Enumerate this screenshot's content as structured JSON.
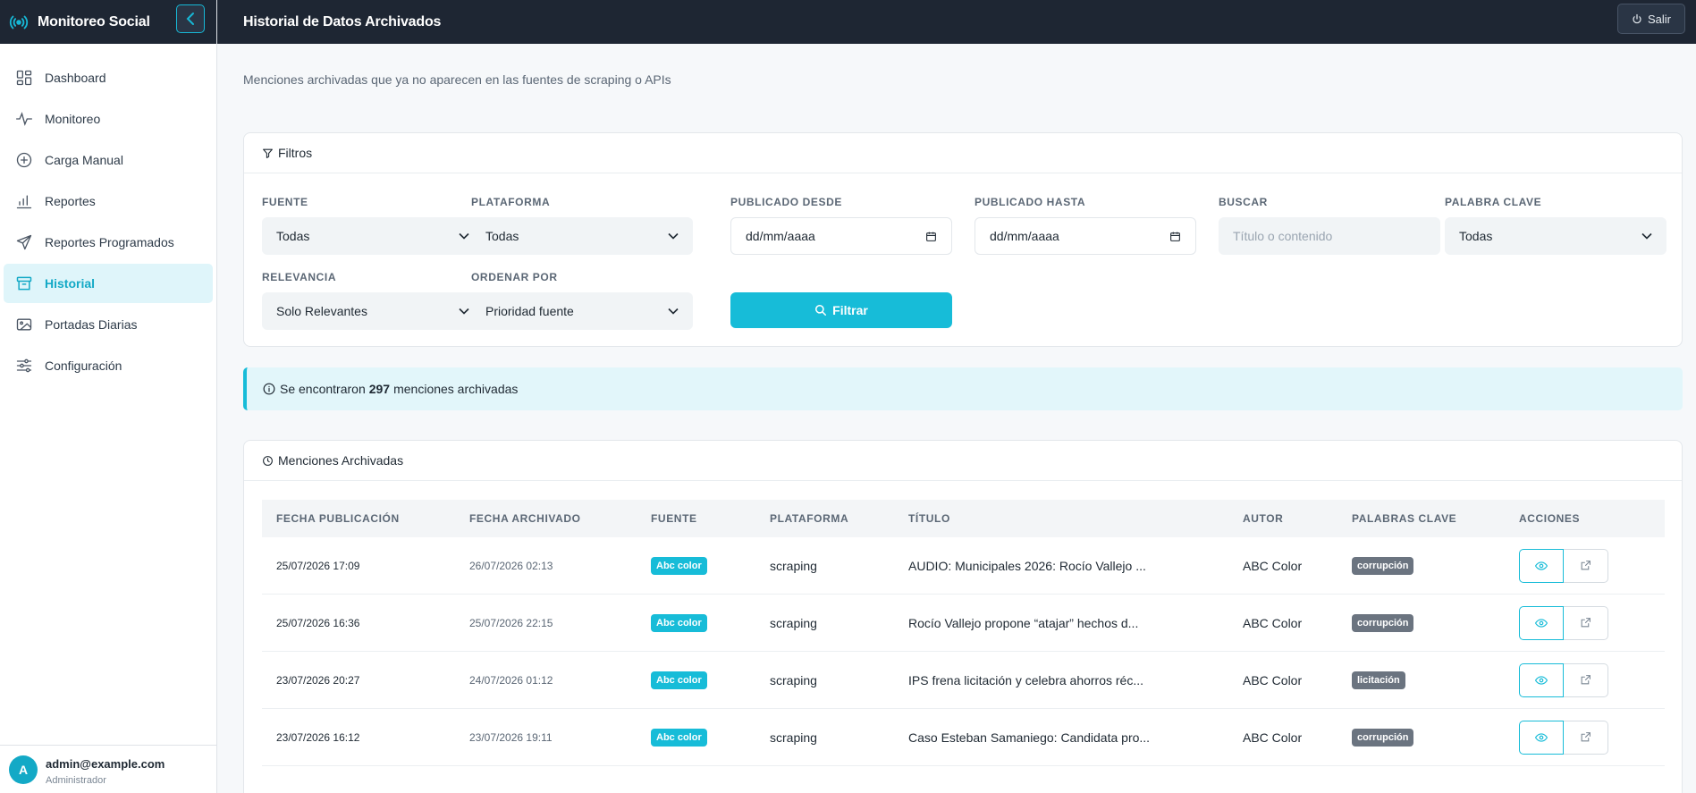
{
  "app": {
    "title": "Monitoreo Social"
  },
  "sidebar": {
    "items": [
      {
        "label": "Dashboard",
        "icon": "dashboard-icon"
      },
      {
        "label": "Monitoreo",
        "icon": "activity-icon"
      },
      {
        "label": "Carga Manual",
        "icon": "plus-circle-icon"
      },
      {
        "label": "Reportes",
        "icon": "bar-chart-icon"
      },
      {
        "label": "Reportes Programados",
        "icon": "send-icon"
      },
      {
        "label": "Historial",
        "icon": "archive-icon",
        "active": true
      },
      {
        "label": "Portadas Diarias",
        "icon": "images-icon"
      },
      {
        "label": "Configuración",
        "icon": "sliders-icon"
      }
    ],
    "user": {
      "initial": "A",
      "email": "admin@example.com",
      "role": "Administrador"
    }
  },
  "header": {
    "title": "Historial de Datos Archivados",
    "logout_label": "Salir"
  },
  "page": {
    "subtitle": "Menciones archivadas que ya no aparecen en las fuentes de scraping o APIs"
  },
  "filters": {
    "title": "Filtros",
    "fuente": {
      "label": "Fuente",
      "value": "Todas"
    },
    "plataforma": {
      "label": "Plataforma",
      "value": "Todas"
    },
    "desde": {
      "label": "Publicado desde",
      "value": "dd/mm/aaaa"
    },
    "hasta": {
      "label": "Publicado hasta",
      "value": "dd/mm/aaaa"
    },
    "buscar": {
      "label": "Buscar",
      "placeholder": "Título o contenido"
    },
    "palabra": {
      "label": "Palabra clave",
      "value": "Todas"
    },
    "relevancia": {
      "label": "Relevancia",
      "value": "Solo Relevantes"
    },
    "ordenar": {
      "label": "Ordenar por",
      "value": "Prioridad fuente"
    },
    "button_label": "Filtrar"
  },
  "alert": {
    "prefix": "Se encontraron",
    "count": "297",
    "suffix": "menciones archivadas"
  },
  "table": {
    "title": "Menciones Archivadas",
    "columns": [
      "Fecha Publicación",
      "Fecha Archivado",
      "Fuente",
      "Plataforma",
      "Título",
      "Autor",
      "Palabras Clave",
      "Acciones"
    ],
    "rows": [
      {
        "published": "25/07/2026 17:09",
        "archived": "26/07/2026 02:13",
        "source": "Abc color",
        "platform": "scraping",
        "title": "AUDIO: Municipales 2026: Rocío Vallejo ...",
        "author": "ABC Color",
        "keyword": "corrupción"
      },
      {
        "published": "25/07/2026 16:36",
        "archived": "25/07/2026 22:15",
        "source": "Abc color",
        "platform": "scraping",
        "title": "Rocío Vallejo propone “atajar” hechos d...",
        "author": "ABC Color",
        "keyword": "corrupción"
      },
      {
        "published": "23/07/2026 20:27",
        "archived": "24/07/2026 01:12",
        "source": "Abc color",
        "platform": "scraping",
        "title": "IPS frena licitación y celebra ahorros réc...",
        "author": "ABC Color",
        "keyword": "licitación"
      },
      {
        "published": "23/07/2026 16:12",
        "archived": "23/07/2026 19:11",
        "source": "Abc color",
        "platform": "scraping",
        "title": "Caso Esteban Samaniego: Candidata pro...",
        "author": "ABC Color",
        "keyword": "corrupción"
      }
    ]
  },
  "colors": {
    "accent": "#17bcd8",
    "dark": "#1e2633",
    "keyword_badge": "#6b7480"
  }
}
